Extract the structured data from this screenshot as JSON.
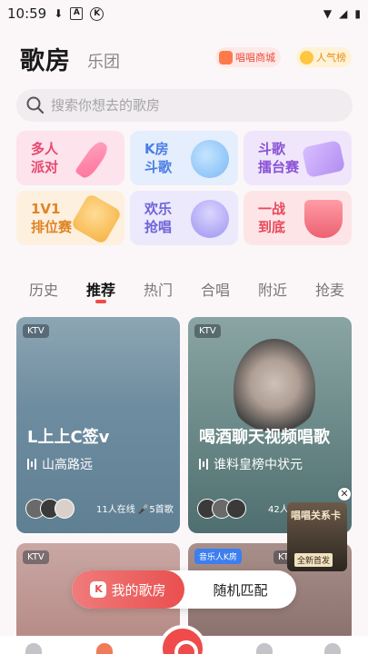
{
  "status_bar": {
    "time": "10:59",
    "left_icons": [
      "download-icon",
      "a-box-icon",
      "k-circle-icon"
    ],
    "right_icons": [
      "wifi-icon",
      "signal-icon",
      "battery-icon"
    ]
  },
  "header": {
    "title": "歌房",
    "subtitle": "乐团",
    "mall_label": "唱唱商城",
    "rank_label": "人气榜"
  },
  "search": {
    "placeholder": "搜索你想去的歌房"
  },
  "categories": [
    {
      "line1": "多人",
      "line2": "派对"
    },
    {
      "line1": "K房",
      "line2": "斗歌"
    },
    {
      "line1": "斗歌",
      "line2": "擂台赛"
    },
    {
      "line1": "1V1",
      "line2": "排位赛"
    },
    {
      "line1": "欢乐",
      "line2": "抢唱"
    },
    {
      "line1": "一战",
      "line2": "到底"
    }
  ],
  "tabs": [
    "历史",
    "推荐",
    "热门",
    "合唱",
    "附近",
    "抢麦"
  ],
  "active_tab": "推荐",
  "rooms": [
    {
      "badge": "KTV",
      "title": "L上上C签v",
      "song": "山高路远",
      "meta": "11人在线 🎤5首歌"
    },
    {
      "badge": "KTV",
      "title": "喝酒聊天视频唱歌",
      "song": "谁料皇榜中状元",
      "meta": "42人在线"
    },
    {
      "badge": "KTV"
    },
    {
      "tag": "音乐人K房",
      "badge": "KT"
    }
  ],
  "float_ad": {
    "text1": "唱唱关系卡",
    "text2": "全新首发"
  },
  "bottom_actions": {
    "mine": "我的歌房",
    "random": "随机匹配",
    "mine_logo": "K"
  },
  "colors": {
    "accent": "#ef4b4b",
    "background": "#fbf7f8"
  }
}
